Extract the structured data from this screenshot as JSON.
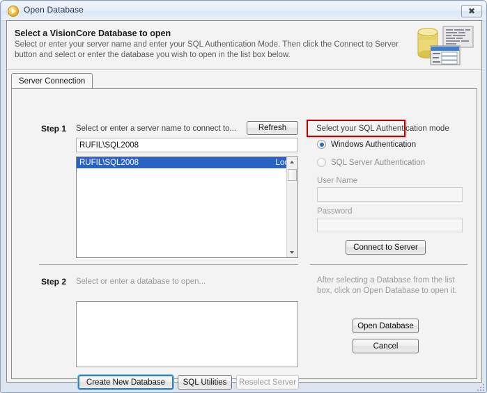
{
  "window": {
    "title": "Open Database",
    "icon": "play-circle-icon",
    "close_label": "✖"
  },
  "header": {
    "title": "Select a VisionCore Database to open",
    "line1": "Select or enter your server name and enter your SQL Authentication Mode.  Then click the Connect to Server",
    "line2": "button and select or enter the database you wish to open in the list box below.",
    "graphic": "database-cylinder-icon"
  },
  "tabs": [
    {
      "label": "Server Connection",
      "selected": true
    }
  ],
  "step1": {
    "label": "Step 1",
    "instruction": "Select or enter a server name to connect to...",
    "refresh_label": "Refresh",
    "server_value": "RUFIL\\SQL2008",
    "server_list": [
      {
        "name": "RUFIL\\SQL2008",
        "detail": "Local",
        "selected": true
      }
    ]
  },
  "auth": {
    "heading": "Select your SQL Authentication mode",
    "options": [
      {
        "label": "Windows Authentication",
        "checked": true,
        "enabled": true,
        "highlighted": true
      },
      {
        "label": "SQL Server Authentication",
        "checked": false,
        "enabled": false,
        "highlighted": false
      }
    ],
    "username_label": "User Name",
    "username_value": "",
    "password_label": "Password",
    "password_value": "",
    "connect_label": "Connect to Server"
  },
  "step2": {
    "label": "Step 2",
    "instruction": "Select or enter a database to open...",
    "database_list": [],
    "create_label": "Create New Database",
    "utilities_label": "SQL Utilities",
    "reselect_label": "Reselect Server"
  },
  "right_panel": {
    "info_line1": "After selecting a Database from the list",
    "info_line2": "box, click on Open Database to open it.",
    "open_label": "Open Database",
    "cancel_label": "Cancel"
  },
  "colors": {
    "selection_blue": "#2a62c4",
    "annotation_red": "#b50000",
    "focus_blue": "#3c7fb1",
    "title_text": "#24384f"
  }
}
